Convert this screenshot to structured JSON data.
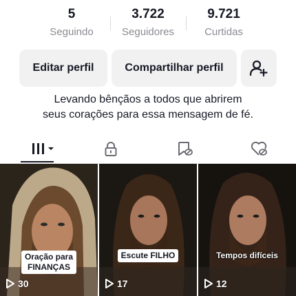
{
  "stats": {
    "following": {
      "value": "5",
      "label": "Seguindo"
    },
    "followers": {
      "value": "3.722",
      "label": "Seguidores"
    },
    "likes": {
      "value": "9.721",
      "label": "Curtidas"
    }
  },
  "buttons": {
    "edit_profile": "Editar perfil",
    "share_profile": "Compartilhar perfil",
    "add_friend_icon": "person-plus-icon"
  },
  "bio": {
    "line1": "Levando bênçãos a todos que abrirem",
    "line2": "seus corações para essa mensagem de fé."
  },
  "tabs": [
    {
      "name": "videos",
      "icon": "grid-icon",
      "active": true
    },
    {
      "name": "private",
      "icon": "lock-icon",
      "active": false
    },
    {
      "name": "reposts",
      "icon": "repost-icon",
      "active": false
    },
    {
      "name": "liked",
      "icon": "heart-icon",
      "active": false
    }
  ],
  "videos": [
    {
      "caption_line1": "Oração para",
      "caption_line2": "FINANÇAS",
      "views": "30"
    },
    {
      "caption": "Escute FILHO",
      "views": "17"
    },
    {
      "caption": "Tempos difíceis",
      "views": "12"
    }
  ],
  "colors": {
    "text": "#161823",
    "muted": "#8a8b91",
    "button_bg": "#f1f1f2"
  }
}
